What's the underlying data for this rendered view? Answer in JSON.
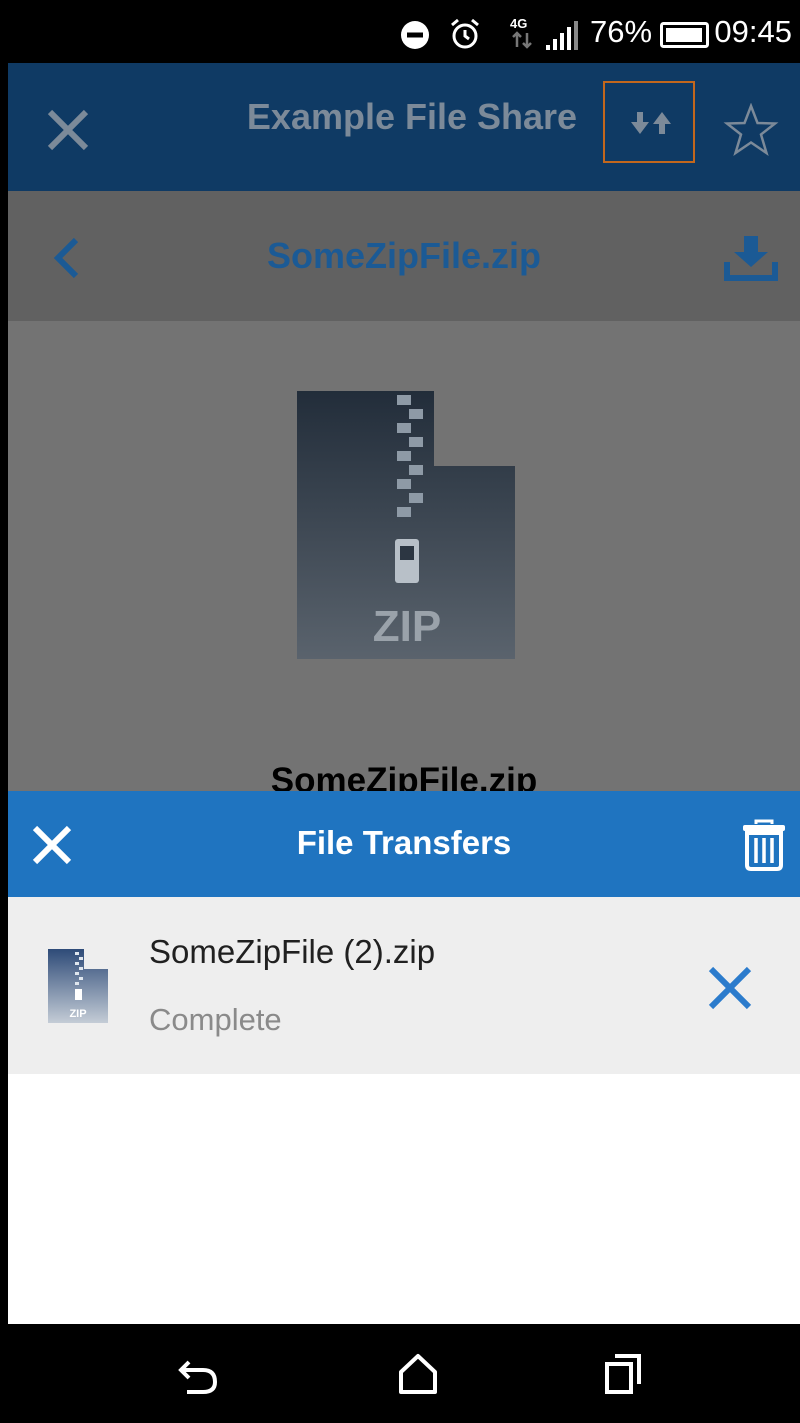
{
  "status_bar": {
    "network": "4G",
    "battery": "76%",
    "time": "09:45",
    "icons": [
      "do-not-disturb-icon",
      "alarm-icon",
      "network-4g-icon",
      "signal-icon",
      "battery-icon"
    ]
  },
  "app_header": {
    "title": "Example File Share",
    "icons": [
      "close-icon",
      "transfer-icon",
      "star-icon"
    ]
  },
  "file_toolbar": {
    "file_name": "SomeZipFile.zip",
    "icons": [
      "back-chevron-icon",
      "download-icon"
    ]
  },
  "preview": {
    "badge_text": "ZIP",
    "caption": "SomeZipFile.zip",
    "icon": "zip-file-icon"
  },
  "transfers": {
    "title": "File Transfers",
    "items": [
      {
        "name": "SomeZipFile (2).zip",
        "status": "Complete",
        "thumb_badge": "ZIP"
      }
    ]
  },
  "colors": {
    "app_header": "#0f3a64",
    "sheet_header": "#1f74c0",
    "accent_blue": "#2b7bcc",
    "highlight": "#c2671d"
  }
}
